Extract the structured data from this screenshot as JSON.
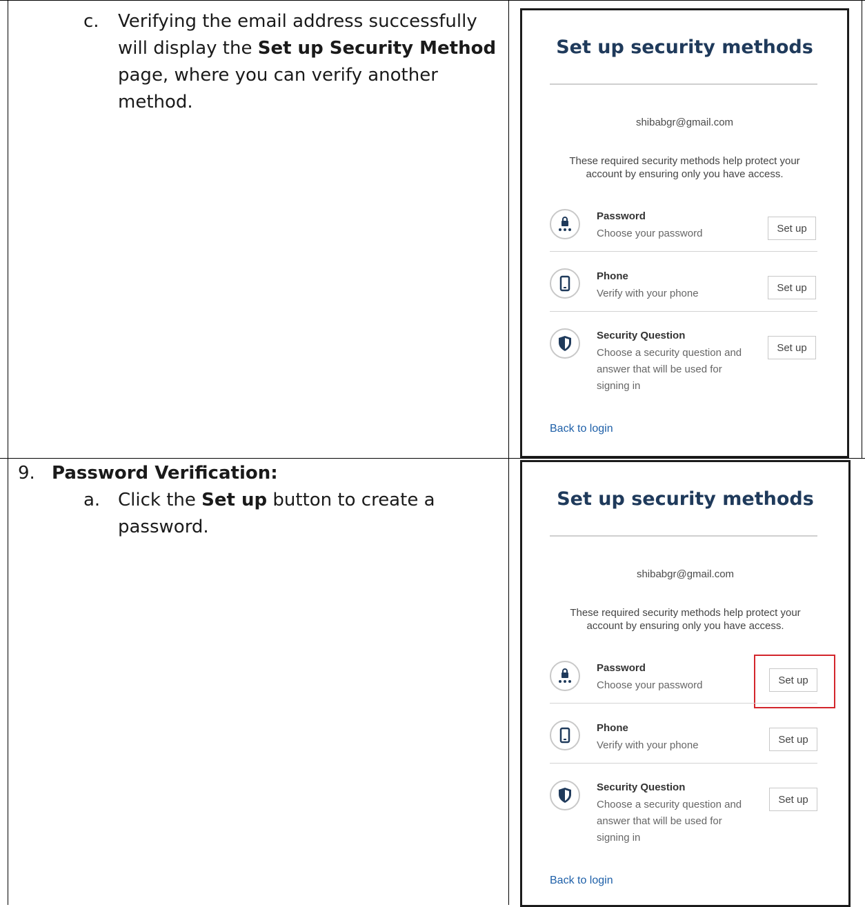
{
  "step_c": {
    "marker": "c.",
    "line1": "Verifying the email address successfully",
    "line2_pre": "will display the ",
    "line2_bold": "Set up Security Method",
    "line3": "page, where you can verify another",
    "line4": "method."
  },
  "step_9": {
    "number": "9.",
    "heading": "Password Verification:",
    "sub_marker": "a.",
    "line1_pre": "Click the ",
    "line1_bold": "Set up",
    "line1_post": " button to create a",
    "line2": "password."
  },
  "panel": {
    "title": "Set up security methods",
    "email": "shibabgr@gmail.com",
    "desc_line1": "These required security methods help protect your",
    "desc_line2": "account by ensuring only you have access.",
    "methods": [
      {
        "name": "Password",
        "sub1": "Choose your password",
        "sub2": "",
        "sub3": "",
        "button": "Set up",
        "icon": "password-icon"
      },
      {
        "name": "Phone",
        "sub1": "Verify with your phone",
        "sub2": "",
        "sub3": "",
        "button": "Set up",
        "icon": "phone-icon"
      },
      {
        "name": "Security Question",
        "sub1": "Choose a security question and",
        "sub2": "answer that will be used for",
        "sub3": "signing in",
        "button": "Set up",
        "icon": "shield-icon"
      }
    ],
    "back_link": "Back to login"
  },
  "colors": {
    "title": "#1f3a5b",
    "link": "#1d5fa8",
    "highlight": "#d3252b"
  }
}
